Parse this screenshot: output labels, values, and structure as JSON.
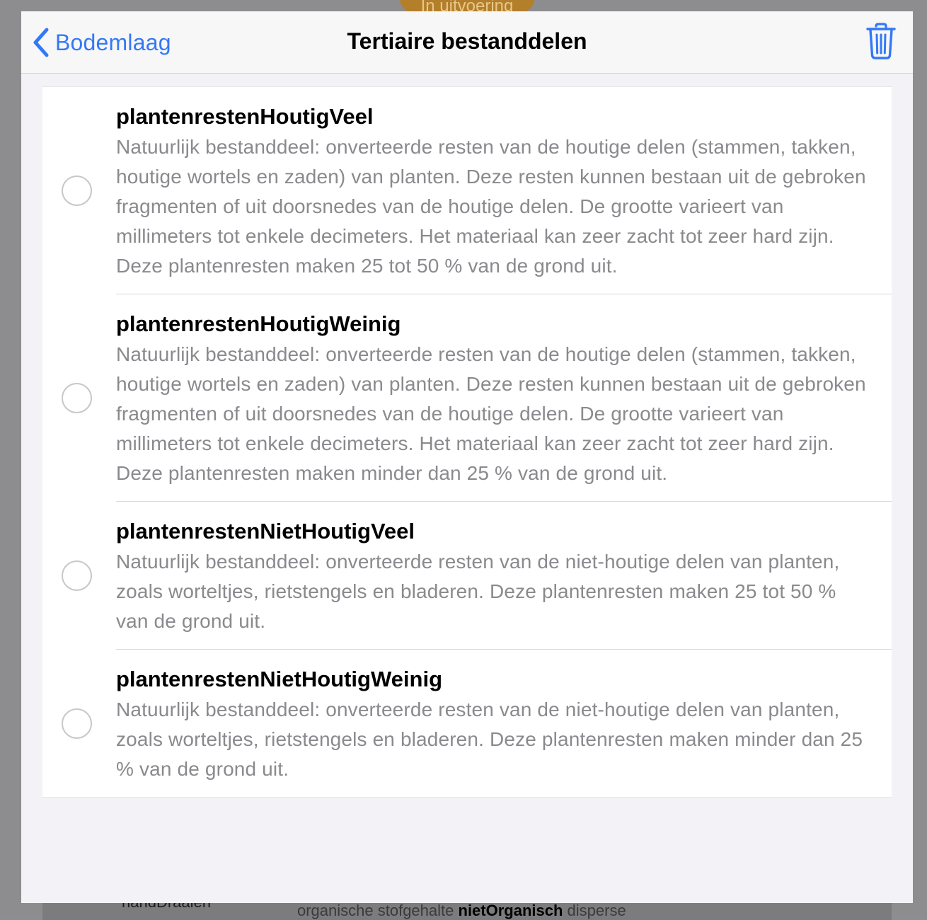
{
  "background": {
    "status_pill": "In uitvoering",
    "left_text": "handDraaien",
    "right_text_prefix": "organische stofgehalte",
    "right_text_bold": "nietOrganisch",
    "right_text_suffix": "disperse"
  },
  "navbar": {
    "back_label": "Bodemlaag",
    "title": "Tertiaire bestanddelen",
    "trash_icon": "trash-icon",
    "accent_color": "#3478f6"
  },
  "options": [
    {
      "title": "plantenrestenHoutigVeel",
      "description": "Natuurlijk bestanddeel: onverteerde resten van de houtige delen (stammen, takken, houtige wortels en zaden) van planten. Deze resten kunnen bestaan uit de gebroken fragmenten of uit doorsnedes van de houtige delen. De grootte varieert van millimeters tot enkele decimeters. Het materiaal kan zeer zacht tot zeer hard zijn. Deze plantenresten maken 25 tot 50 % van de grond uit.",
      "selected": false
    },
    {
      "title": "plantenrestenHoutigWeinig",
      "description": "Natuurlijk bestanddeel: onverteerde resten van de houtige delen (stammen, takken, houtige wortels en zaden) van planten. Deze resten kunnen bestaan uit de gebroken fragmenten of uit doorsnedes van de houtige delen. De grootte varieert van millimeters tot enkele decimeters. Het materiaal kan zeer zacht tot zeer hard zijn. Deze plantenresten maken minder dan 25 % van de grond uit.",
      "selected": false
    },
    {
      "title": "plantenrestenNietHoutigVeel",
      "description": "Natuurlijk bestanddeel: onverteerde resten van de niet-houtige delen van planten, zoals worteltjes, rietstengels en bladeren. Deze plantenresten maken 25 tot 50 % van de grond uit.",
      "selected": false
    },
    {
      "title": "plantenrestenNietHoutigWeinig",
      "description": "Natuurlijk bestanddeel: onverteerde resten van de niet-houtige delen van planten, zoals worteltjes, rietstengels en bladeren. Deze plantenresten maken minder dan 25 % van de grond uit.",
      "selected": false
    }
  ]
}
